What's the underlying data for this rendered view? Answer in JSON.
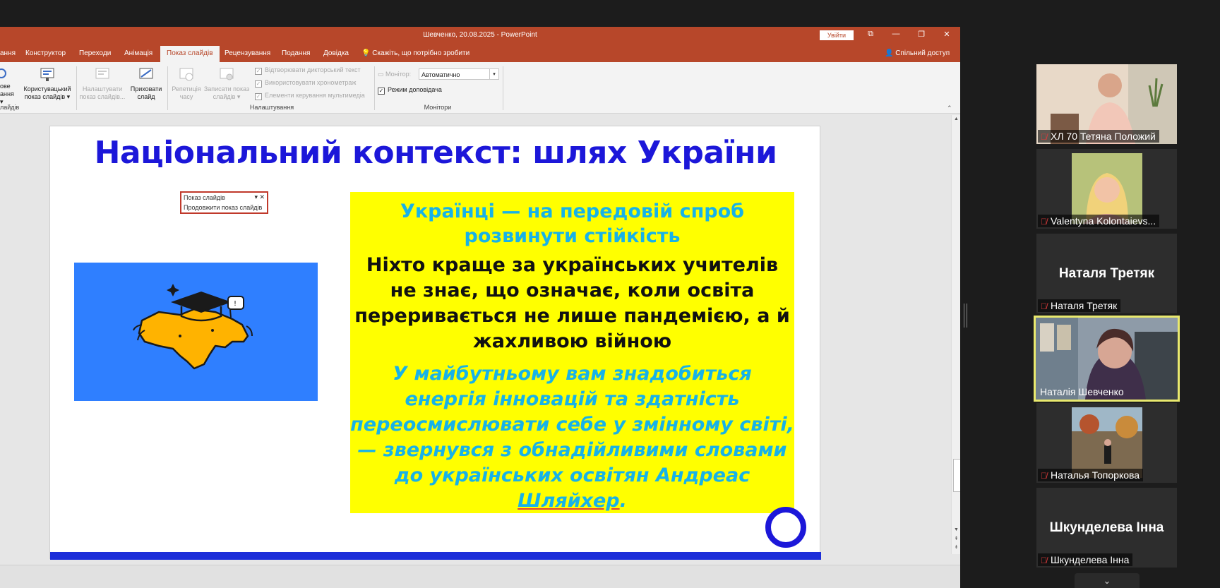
{
  "window": {
    "title": "Шевченко, 20.08.2025  -  PowerPoint",
    "signin_label": "Увійти",
    "controls": [
      "⧉",
      "—",
      "❐",
      "✕"
    ]
  },
  "tabs": [
    {
      "label": "ання"
    },
    {
      "label": "Конструктор"
    },
    {
      "label": "Переходи"
    },
    {
      "label": "Анімація"
    },
    {
      "label": "Показ слайдів",
      "active": true
    },
    {
      "label": "Рецензування"
    },
    {
      "label": "Подання"
    },
    {
      "label": "Довідка"
    }
  ],
  "tell_me": "Скажіть, що потрібно зробити",
  "share": "Спільний доступ",
  "ribbon": {
    "btn_start_partial": [
      "ове",
      "ання ▾",
      "лайдів"
    ],
    "btn_custom": [
      "Користувацький",
      "показ слайдів ▾"
    ],
    "btn_setup": [
      "Налаштувати",
      "показ слайдів..."
    ],
    "btn_hide": [
      "Приховати",
      "слайд"
    ],
    "btn_rehearse": [
      "Репетиція",
      "часу"
    ],
    "btn_record": [
      "Записати показ",
      "слайдів ▾"
    ],
    "chk_narration": "Відтворювати дикторський текст",
    "chk_timings": "Використовувати хронометраж",
    "chk_media": "Елементи керування мультимедіа",
    "group_setup": "Налаштування",
    "monitor_label": "Монітор:",
    "monitor_value": "Автоматично",
    "presenter_view": "Режим доповідача",
    "group_monitors": "Монітори"
  },
  "slide": {
    "title": "Національний контекст: шлях України",
    "popup_title": "Показ слайдів",
    "popup_action": "Продовжити показ слайдів",
    "box_heading": "Українці — на передовій спроб розвинути стійкість",
    "box_body": "Ніхто краще за українських учителів не знає, що означає, коли освіта переривається не лише пандемією, а й жахливою війною",
    "box_quote_main": "У майбутньому вам знадобиться енергія інновацій та здатність переосмислювати себе у змінному світі, — звернувся з обнадійливими словами до українських освітян Андреас ",
    "box_quote_name": "Шляйхер",
    "box_quote_end": "."
  },
  "participants": [
    {
      "name": "ХЛ 70 Тетяна Положий",
      "muted": true
    },
    {
      "name": "Valentyna Kolontaievs...",
      "muted": true
    },
    {
      "name": "Наталя Третяк",
      "muted": true,
      "big_name": "Наталя Третяк"
    },
    {
      "name": "Наталія Шевченко",
      "muted": false,
      "active": true
    },
    {
      "name": "Наталья Топоркова",
      "muted": true
    },
    {
      "name": "Шкунделева Інна",
      "muted": true,
      "big_name": "Шкунделева Інна"
    }
  ],
  "colors": {
    "powerpoint_accent": "#b7472a",
    "slide_title": "#1c17d9",
    "highlight_box": "#ffff00",
    "cyan_text": "#17b2e8",
    "active_speaker_border": "#e9e96e"
  }
}
